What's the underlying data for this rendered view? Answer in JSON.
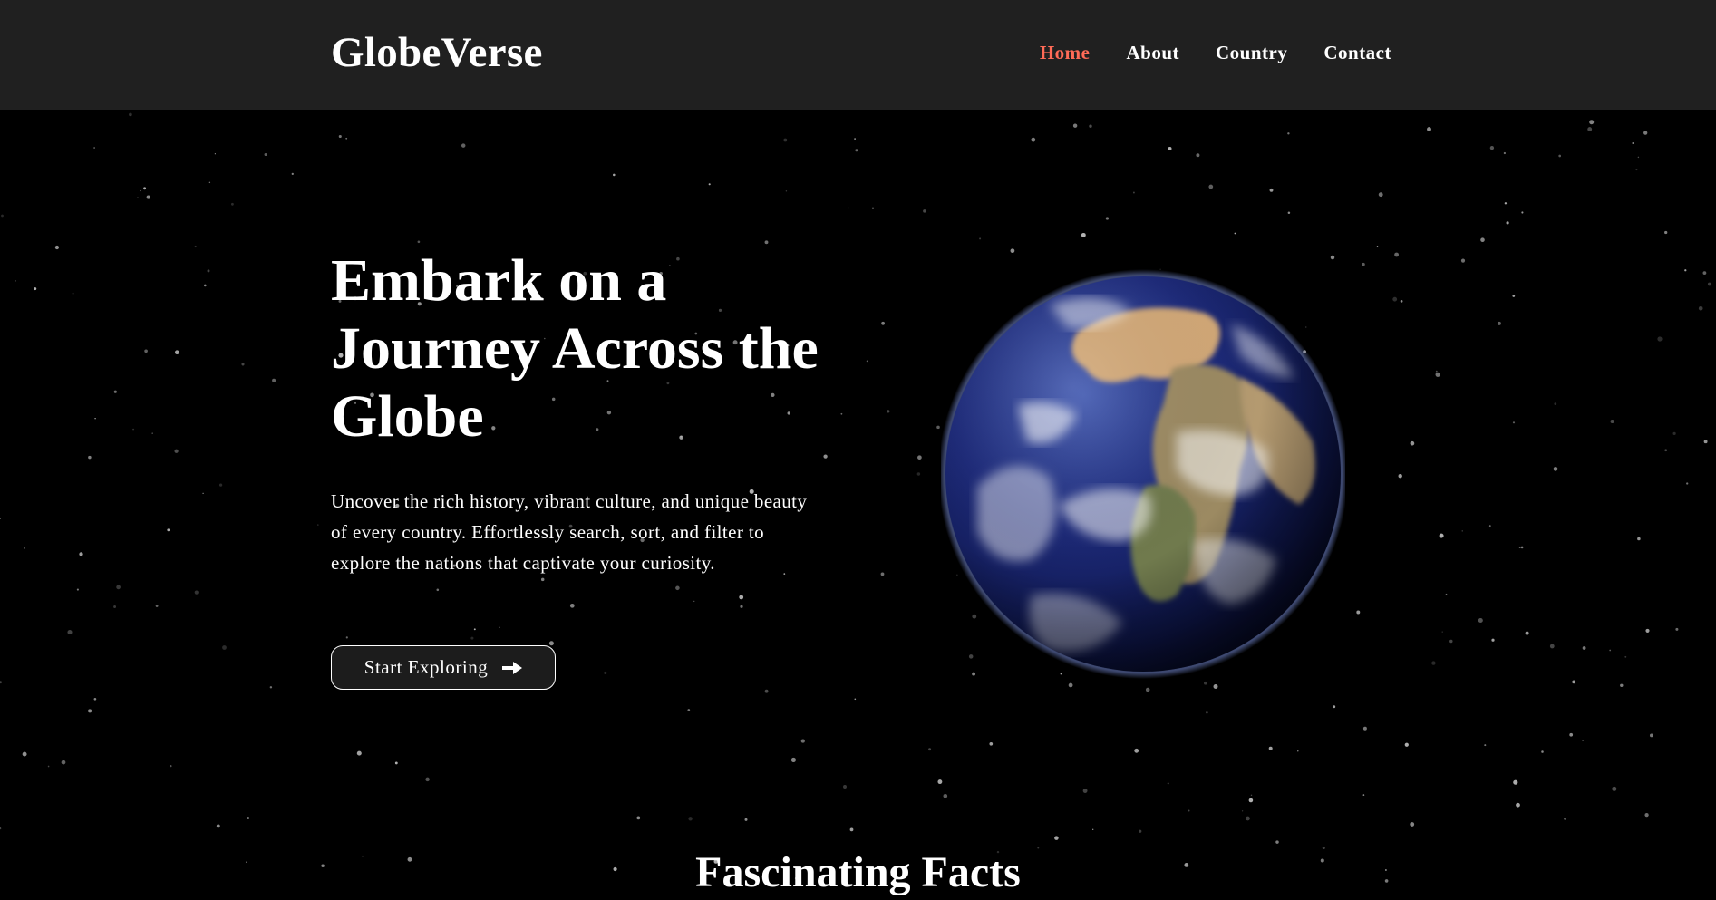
{
  "navbar": {
    "logo": "GlobeVerse",
    "links": [
      {
        "label": "Home",
        "active": true
      },
      {
        "label": "About",
        "active": false
      },
      {
        "label": "Country",
        "active": false
      },
      {
        "label": "Contact",
        "active": false
      }
    ],
    "active_color": "#ff6b57",
    "background": "#202020"
  },
  "hero": {
    "title": "Embark on a Journey Across the Globe",
    "description": "Uncover the rich history, vibrant culture, and unique beauty of every country. Effortlessly search, sort, and filter to explore the nations that captivate your curiosity.",
    "cta": {
      "label": "Start Exploring",
      "icon": "arrow-right-icon"
    },
    "image": "earth-globe-image"
  },
  "facts": {
    "title": "Fascinating Facts"
  }
}
